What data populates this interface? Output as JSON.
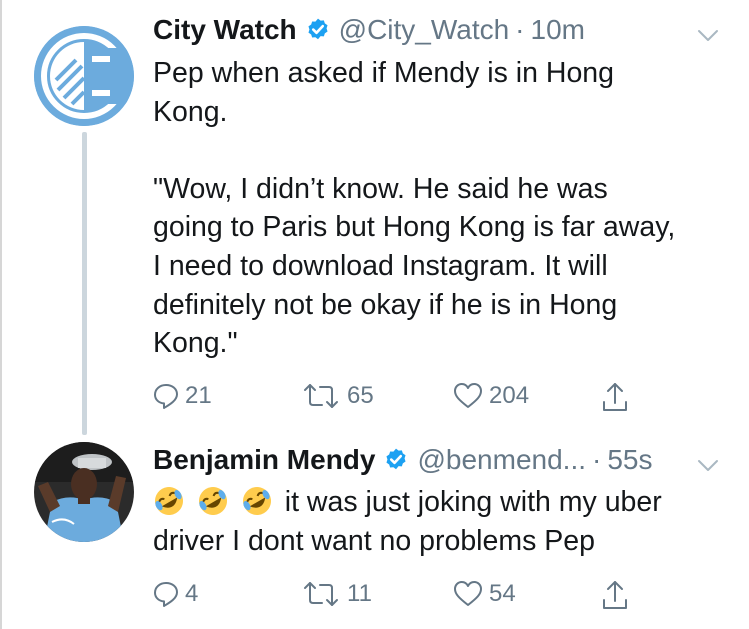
{
  "tweets": [
    {
      "author": "City Watch",
      "handle": "@City_Watch",
      "separator": "·",
      "time": "10m",
      "text": "Pep when asked if Mendy is in Hong\nKong.\n\n\"Wow, I didn’t know. He said he was\ngoing to Paris but Hong Kong is far away,\nI need to download Instagram. It will\ndefinitely not be okay if he is in Hong\nKong.\"",
      "replies": "21",
      "retweets": "65",
      "likes": "204",
      "avatar_icon": "city-watch-logo"
    },
    {
      "author": "Benjamin Mendy",
      "handle": "@benmend...",
      "separator": "·",
      "time": "55s",
      "emoji_count": 3,
      "emoji": "rolling-on-floor-laughing",
      "text_line1": "it was just joking with my uber",
      "text_line2": "driver I dont want no problems Pep",
      "replies": "4",
      "retweets": "11",
      "likes": "54",
      "avatar_icon": "player-photo"
    }
  ],
  "colors": {
    "brand_blue": "#1da1f2",
    "secondary_text": "#657786",
    "logo_blue": "#6cabdd",
    "thread_line": "#ccd6dd"
  }
}
